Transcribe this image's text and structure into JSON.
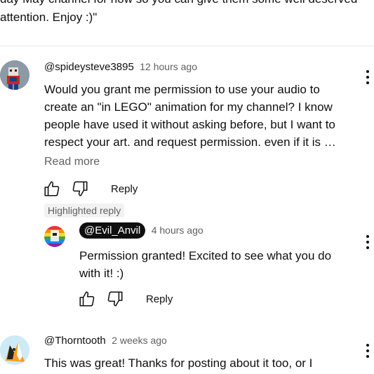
{
  "previous_comment": {
    "line1": "day May channel for now so you can give them some well deserved",
    "line2": "attention. Enjoy :)\""
  },
  "comments": [
    {
      "handle": "@spideysteve3895",
      "time": "12 hours ago",
      "text_lines": [
        "Would you grant me permission to use your audio to",
        "create an \"in LEGO\" animation for my channel? I know",
        "people have used it without asking before, but I want to",
        "respect your art. and request permission. even if it is …"
      ],
      "read_more": "Read more",
      "reply_label": "Reply",
      "highlighted_label": "Highlighted reply",
      "reply": {
        "handle": "@Evil_Anvil",
        "time": "4 hours ago",
        "text_lines": [
          "Permission granted! Excited to see what you do",
          "with it! :)"
        ],
        "reply_label": "Reply"
      }
    },
    {
      "handle": "@Thorntooth",
      "time": "2 weeks ago",
      "text_lines": [
        "This was great! Thanks for posting about it too, or I"
      ]
    }
  ],
  "icons": {
    "like": "thumb-up-icon",
    "dislike": "thumb-down-icon",
    "more": "more-vert-icon"
  },
  "colors": {
    "text": "#0f0f0f",
    "secondary": "#606060",
    "owner_badge": "#0f0f0f"
  }
}
